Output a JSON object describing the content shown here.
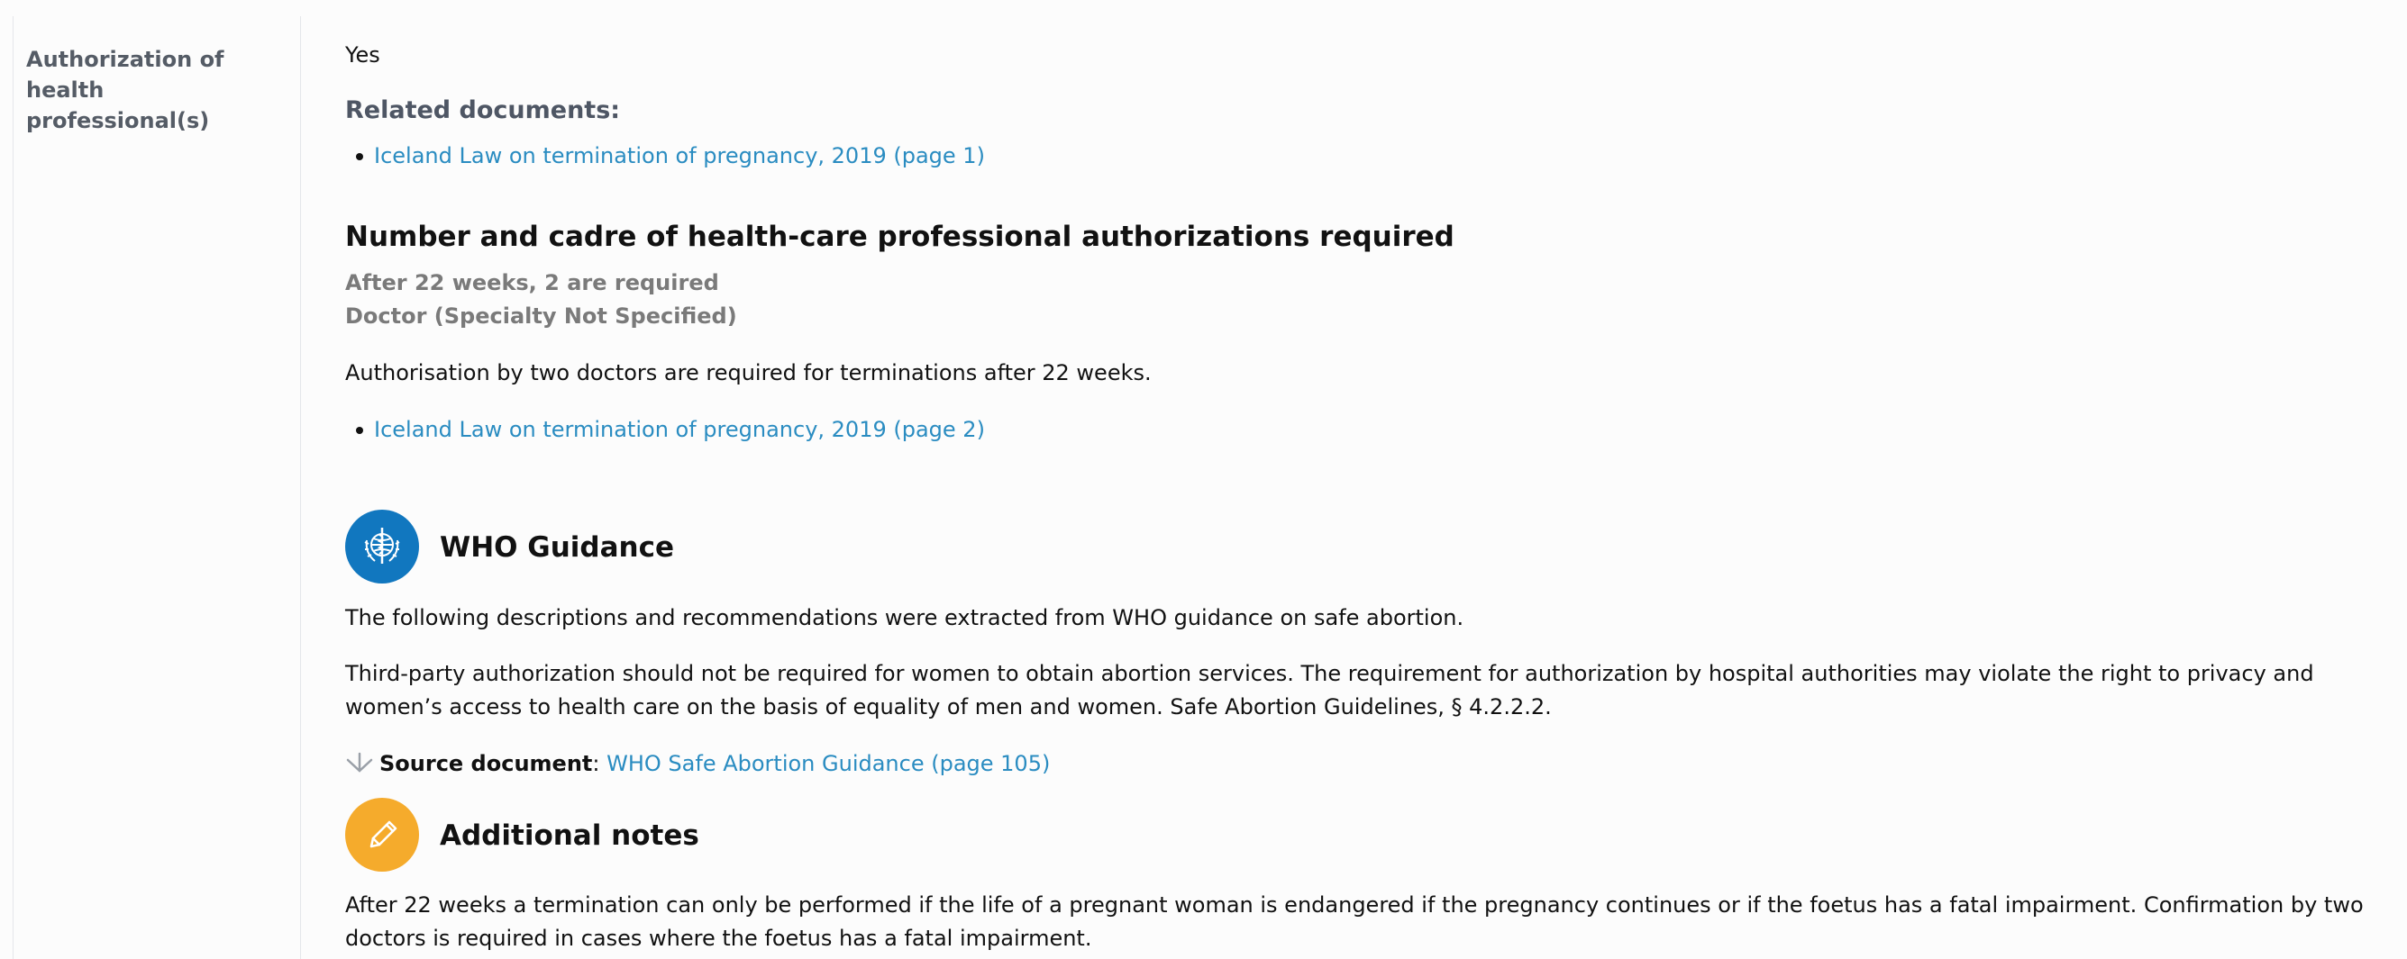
{
  "row": {
    "label": "Authorization of health professional(s)"
  },
  "authorization": {
    "answer": "Yes",
    "related_heading": "Related documents:",
    "related_link": "Iceland Law on termination of pregnancy, 2019 (page 1)"
  },
  "cadre": {
    "heading": "Number and cadre of health-care professional authorizations required",
    "requirement": "After 22 weeks, 2 are required",
    "specialty": "Doctor (Specialty Not Specified)",
    "description": "Authorisation by two doctors are required for terminations after 22 weeks.",
    "link": "Iceland Law on termination of pregnancy, 2019 (page 2)"
  },
  "who_guidance": {
    "title": "WHO Guidance",
    "intro": "The following descriptions and recommendations were extracted from WHO guidance on safe abortion.",
    "recommendation": "Third-party authorization should not be required for women to obtain abortion services. The requirement for authorization by hospital authorities may violate the right to privacy and women’s access to health care on the basis of equality of men and women. Safe Abortion Guidelines, § 4.2.2.2.",
    "source_label": "Source document",
    "source_sep": ":",
    "source_link": "WHO Safe Abortion Guidance (page 105)",
    "badge_color": "#1177bf",
    "icon": "who-emblem-icon"
  },
  "additional_notes": {
    "title": "Additional notes",
    "text": "After 22 weeks a termination can only be performed if the life of a pregnant woman is endangered if the pregnancy continues or if the foetus has a fatal impairment. Confirmation by two doctors is required in cases where the foetus has a fatal impairment.",
    "badge_color": "#f5ab2c",
    "icon": "pencil-icon"
  },
  "colors": {
    "link": "#2a8cc1",
    "label_gray": "#555c66",
    "meta_gray": "#7a7a7a"
  }
}
